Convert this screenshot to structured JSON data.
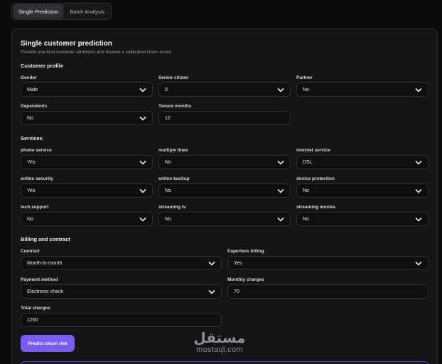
{
  "tabs": [
    {
      "label": "Single Prediction",
      "active": true
    },
    {
      "label": "Batch Analysis",
      "active": false
    }
  ],
  "card": {
    "title": "Single customer prediction",
    "subtitle": "Provide practical customer attributes and receive a calibrated churn score."
  },
  "customer_profile": {
    "heading": "Customer profile",
    "gender": {
      "label": "Gender",
      "value": "Male"
    },
    "senior_citizen": {
      "label": "Senior citizen",
      "value": "0"
    },
    "partner": {
      "label": "Partner",
      "value": "No"
    },
    "dependents": {
      "label": "Dependents",
      "value": "No"
    },
    "tenure": {
      "label": "Tenure months",
      "value": "12"
    }
  },
  "services": {
    "heading": "Services",
    "phone_service": {
      "label": "phone service",
      "value": "Yes"
    },
    "multiple_lines": {
      "label": "multiple lines",
      "value": "No"
    },
    "internet_service": {
      "label": "internet service",
      "value": "DSL"
    },
    "online_security": {
      "label": "online security",
      "value": "Yes"
    },
    "online_backup": {
      "label": "online backup",
      "value": "No"
    },
    "device_protection": {
      "label": "device protection",
      "value": "No"
    },
    "tech_support": {
      "label": "tech support",
      "value": "No"
    },
    "streaming_tv": {
      "label": "streaming tv",
      "value": "No"
    },
    "streaming_movies": {
      "label": "streaming movies",
      "value": "No"
    }
  },
  "billing": {
    "heading": "Billing and contract",
    "contract": {
      "label": "Contract",
      "value": "Month-to-month"
    },
    "paperless_billing": {
      "label": "Paperless billing",
      "value": "Yes"
    },
    "payment_method": {
      "label": "Payment method",
      "value": "Electronic check"
    },
    "monthly_charges": {
      "label": "Monthly charges",
      "value": "70"
    },
    "total_charges": {
      "label": "Total charges",
      "value": "1200"
    }
  },
  "predict_button": "Predict churn risk",
  "watermark": {
    "arabic": "مستقل",
    "latin": "mostaql.com"
  },
  "colors": {
    "accent": "#7a5cf0",
    "background": "#0c0c0e",
    "card": "#151517"
  }
}
